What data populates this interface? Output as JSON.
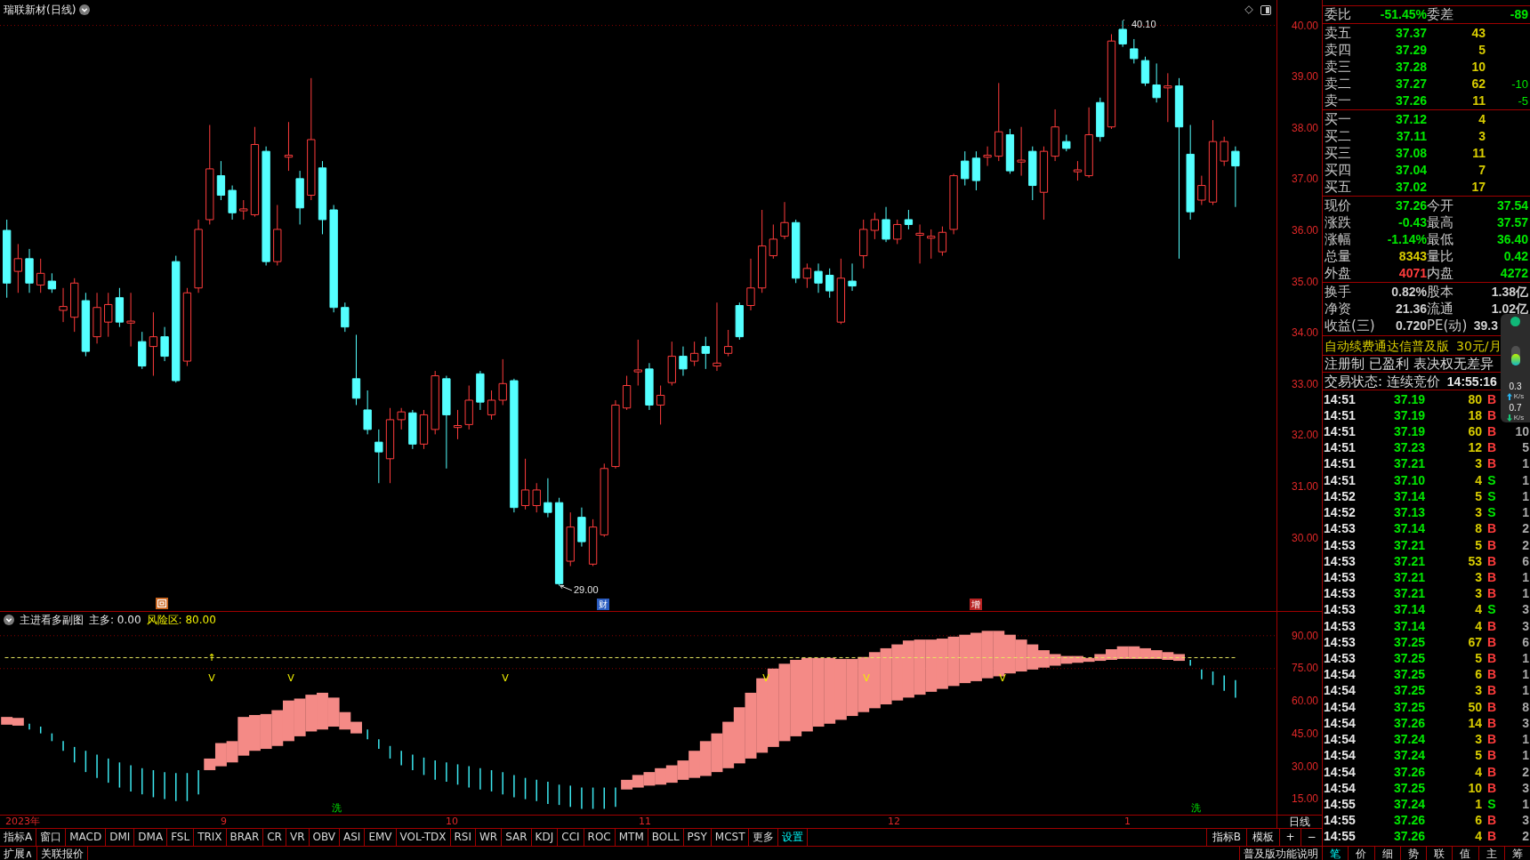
{
  "chart": {
    "title": "瑞联新材(日线)",
    "high_label": "40.10",
    "low_label": "29.00",
    "price_ticks": [
      "40.00",
      "39.00",
      "38.00",
      "37.00",
      "36.00",
      "35.00",
      "34.00",
      "33.00",
      "32.00",
      "31.00",
      "30.00"
    ],
    "event_marks": [
      {
        "kind": "icon",
        "color": "#c8641e"
      },
      {
        "kind": "text",
        "text": "财",
        "color": "#2a5cc0"
      },
      {
        "kind": "text",
        "text": "增",
        "color": "#b82424"
      }
    ]
  },
  "indicator": {
    "name": "主进看多副图",
    "values": [
      {
        "text": "主多: 0.00",
        "color": "#e6e6e6"
      },
      {
        "text": "风险区: 80.00",
        "color": "#f0f000"
      }
    ],
    "ticks": [
      "90.00",
      "75.00",
      "60.00",
      "45.00",
      "30.00",
      "15.00"
    ],
    "signals": [
      {
        "kind": "arrow",
        "text": "↑"
      },
      {
        "kind": "v",
        "text": "V"
      },
      {
        "kind": "v",
        "text": "V"
      },
      {
        "kind": "v",
        "text": "V"
      },
      {
        "kind": "v",
        "text": "V"
      },
      {
        "kind": "v",
        "text": "V"
      },
      {
        "kind": "v",
        "text": "V"
      },
      {
        "kind": "wash",
        "text": "洗"
      },
      {
        "kind": "wash",
        "text": "洗"
      }
    ]
  },
  "x_axis": {
    "labels": [
      "2023年",
      "9",
      "10",
      "11",
      "12",
      "1"
    ],
    "period": "日线"
  },
  "toolbar": {
    "tabs": [
      {
        "label": "指标A",
        "highlighted": false
      },
      {
        "label": "窗口",
        "highlighted": false
      },
      {
        "label": "MACD",
        "highlighted": false
      },
      {
        "label": "DMI",
        "highlighted": false
      },
      {
        "label": "DMA",
        "highlighted": false
      },
      {
        "label": "FSL",
        "highlighted": false
      },
      {
        "label": "TRIX",
        "highlighted": false
      },
      {
        "label": "BRAR",
        "highlighted": false
      },
      {
        "label": "CR",
        "highlighted": false
      },
      {
        "label": "VR",
        "highlighted": false
      },
      {
        "label": "OBV",
        "highlighted": false
      },
      {
        "label": "ASI",
        "highlighted": false
      },
      {
        "label": "EMV",
        "highlighted": false
      },
      {
        "label": "VOL-TDX",
        "highlighted": false
      },
      {
        "label": "RSI",
        "highlighted": false
      },
      {
        "label": "WR",
        "highlighted": false
      },
      {
        "label": "SAR",
        "highlighted": false
      },
      {
        "label": "KDJ",
        "highlighted": false
      },
      {
        "label": "CCI",
        "highlighted": false
      },
      {
        "label": "ROC",
        "highlighted": false
      },
      {
        "label": "MTM",
        "highlighted": false
      },
      {
        "label": "BOLL",
        "highlighted": false
      },
      {
        "label": "PSY",
        "highlighted": false
      },
      {
        "label": "MCST",
        "highlighted": false
      },
      {
        "label": "更多",
        "highlighted": false
      },
      {
        "label": "设置",
        "highlighted": true
      }
    ],
    "right": [
      "指标B",
      "模板",
      "+",
      "−"
    ]
  },
  "status_bar": {
    "left": [
      "扩展∧",
      "关联报价"
    ],
    "right": "普及版功能说明"
  },
  "panel_tabs": [
    {
      "label": "笔",
      "selected": true
    },
    {
      "label": "价",
      "selected": false
    },
    {
      "label": "细",
      "selected": false
    },
    {
      "label": "势",
      "selected": false
    },
    {
      "label": "联",
      "selected": false
    },
    {
      "label": "值",
      "selected": false
    },
    {
      "label": "主",
      "selected": false
    },
    {
      "label": "筹",
      "selected": false
    }
  ],
  "quote": {
    "ratio": [
      {
        "label": "委比",
        "value": "-51.45%"
      },
      {
        "label": "委差",
        "value": "-89"
      }
    ],
    "asks": [
      {
        "label": "卖五",
        "price": "37.37",
        "volume": "43"
      },
      {
        "label": "卖四",
        "price": "37.29",
        "volume": "5"
      },
      {
        "label": "卖三",
        "price": "37.28",
        "volume": "10"
      },
      {
        "label": "卖二",
        "price": "37.27",
        "volume": "62",
        "change": "-10"
      },
      {
        "label": "卖一",
        "price": "37.26",
        "volume": "11",
        "change": "-5"
      }
    ],
    "bids": [
      {
        "label": "买一",
        "price": "37.12",
        "volume": "4"
      },
      {
        "label": "买二",
        "price": "37.11",
        "volume": "3"
      },
      {
        "label": "买三",
        "price": "37.08",
        "volume": "11"
      },
      {
        "label": "买四",
        "price": "37.04",
        "volume": "7"
      },
      {
        "label": "买五",
        "price": "37.02",
        "volume": "17"
      }
    ],
    "stats": [
      {
        "label": "现价",
        "value": "37.26",
        "color": "#00e800"
      },
      {
        "label": "今开",
        "value": "37.54",
        "color": "#00e800"
      },
      {
        "label": "涨跌",
        "value": "-0.43",
        "color": "#00e800"
      },
      {
        "label": "最高",
        "value": "37.57",
        "color": "#00e800"
      },
      {
        "label": "涨幅",
        "value": "-1.14%",
        "color": "#00e800"
      },
      {
        "label": "最低",
        "value": "36.40",
        "color": "#00e800"
      },
      {
        "label": "总量",
        "value": "8343",
        "color": "#d8cc00"
      },
      {
        "label": "量比",
        "value": "0.42",
        "color": "#00e800"
      },
      {
        "label": "外盘",
        "value": "4071",
        "color": "#ff3c3c"
      },
      {
        "label": "内盘",
        "value": "4272",
        "color": "#00e800"
      }
    ],
    "fundamentals": [
      {
        "label": "换手",
        "value": "0.82%"
      },
      {
        "label": "股本",
        "value": "1.38亿"
      },
      {
        "label": "净资",
        "value": "21.36"
      },
      {
        "label": "流通",
        "value": "1.02亿"
      },
      {
        "label": "收益(三)",
        "value": "0.720"
      },
      {
        "label": "PE(动)",
        "value": "39.3"
      }
    ],
    "promo": {
      "text": "自动续费通达信普及版",
      "price": "30元/月"
    },
    "tags": "注册制 已盈利 表决权无差异",
    "trade_status": {
      "label": "交易状态: 连续竞价",
      "time": "14:55:16"
    },
    "trades": [
      {
        "time": "14:51",
        "price": "37.19",
        "volume": "80",
        "side": "B",
        "kind": "buy"
      },
      {
        "time": "14:51",
        "price": "37.19",
        "volume": "18",
        "side": "B",
        "kind": "buy"
      },
      {
        "time": "14:51",
        "price": "37.19",
        "volume": "60",
        "side": "B",
        "kind": "buy",
        "count": "10"
      },
      {
        "time": "14:51",
        "price": "37.23",
        "volume": "12",
        "side": "B",
        "kind": "buy",
        "count": "5"
      },
      {
        "time": "14:51",
        "price": "37.21",
        "volume": "3",
        "side": "B",
        "kind": "buy",
        "count": "1"
      },
      {
        "time": "14:51",
        "price": "37.10",
        "volume": "4",
        "side": "S",
        "kind": "sell",
        "count": "1"
      },
      {
        "time": "14:52",
        "price": "37.14",
        "volume": "5",
        "side": "S",
        "kind": "sell",
        "count": "1"
      },
      {
        "time": "14:52",
        "price": "37.13",
        "volume": "3",
        "side": "S",
        "kind": "sell",
        "count": "1"
      },
      {
        "time": "14:53",
        "price": "37.14",
        "volume": "8",
        "side": "B",
        "kind": "buy",
        "count": "2"
      },
      {
        "time": "14:53",
        "price": "37.21",
        "volume": "5",
        "side": "B",
        "kind": "buy",
        "count": "2"
      },
      {
        "time": "14:53",
        "price": "37.21",
        "volume": "53",
        "side": "B",
        "kind": "buy",
        "count": "6"
      },
      {
        "time": "14:53",
        "price": "37.21",
        "volume": "3",
        "side": "B",
        "kind": "buy",
        "count": "1"
      },
      {
        "time": "14:53",
        "price": "37.21",
        "volume": "3",
        "side": "B",
        "kind": "buy",
        "count": "1"
      },
      {
        "time": "14:53",
        "price": "37.14",
        "volume": "4",
        "side": "S",
        "kind": "sell",
        "count": "3"
      },
      {
        "time": "14:53",
        "price": "37.14",
        "volume": "4",
        "side": "B",
        "kind": "buy",
        "count": "3"
      },
      {
        "time": "14:53",
        "price": "37.25",
        "volume": "67",
        "side": "B",
        "kind": "buy",
        "count": "6"
      },
      {
        "time": "14:53",
        "price": "37.25",
        "volume": "5",
        "side": "B",
        "kind": "buy",
        "count": "1"
      },
      {
        "time": "14:54",
        "price": "37.25",
        "volume": "6",
        "side": "B",
        "kind": "buy",
        "count": "1"
      },
      {
        "time": "14:54",
        "price": "37.25",
        "volume": "3",
        "side": "B",
        "kind": "buy",
        "count": "1"
      },
      {
        "time": "14:54",
        "price": "37.25",
        "volume": "50",
        "side": "B",
        "kind": "buy",
        "count": "8"
      },
      {
        "time": "14:54",
        "price": "37.26",
        "volume": "14",
        "side": "B",
        "kind": "buy",
        "count": "3"
      },
      {
        "time": "14:54",
        "price": "37.24",
        "volume": "3",
        "side": "B",
        "kind": "buy",
        "count": "1"
      },
      {
        "time": "14:54",
        "price": "37.24",
        "volume": "5",
        "side": "B",
        "kind": "buy",
        "count": "1"
      },
      {
        "time": "14:54",
        "price": "37.26",
        "volume": "4",
        "side": "B",
        "kind": "buy",
        "count": "2"
      },
      {
        "time": "14:54",
        "price": "37.25",
        "volume": "10",
        "side": "B",
        "kind": "buy",
        "count": "3"
      },
      {
        "time": "14:55",
        "price": "37.24",
        "volume": "1",
        "side": "S",
        "kind": "sell",
        "count": "1"
      },
      {
        "time": "14:55",
        "price": "37.26",
        "volume": "6",
        "side": "B",
        "kind": "buy",
        "count": "3"
      },
      {
        "time": "14:55",
        "price": "37.26",
        "volume": "4",
        "side": "B",
        "kind": "buy",
        "count": "2"
      }
    ]
  },
  "speed_monitor": {
    "upload": "0.3",
    "upload_unit": "K/s",
    "download": "0.7",
    "download_unit": "K/s"
  }
}
